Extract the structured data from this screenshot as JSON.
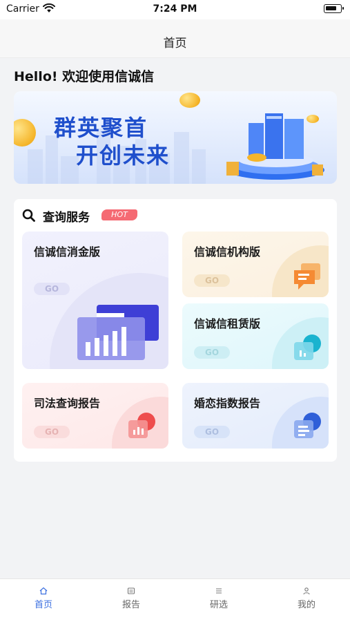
{
  "status_bar": {
    "carrier": "Carrier",
    "time": "7:24 PM"
  },
  "nav": {
    "title": "首页"
  },
  "greeting": "Hello! 欢迎使用信诚信",
  "banner": {
    "slogan_line1": "群英聚首",
    "slogan_line2": "开创未来"
  },
  "services": {
    "title": "查询服务",
    "hot_badge": "HOT",
    "tiles": [
      {
        "label": "信诚信消金版",
        "go": "GO"
      },
      {
        "label": "信诚信机构版",
        "go": "GO"
      },
      {
        "label": "信诚信租赁版",
        "go": "GO"
      },
      {
        "label": "司法查询报告",
        "go": "GO"
      },
      {
        "label": "婚恋指数报告",
        "go": "GO"
      }
    ]
  },
  "tab_bar": {
    "active_color": "#3b6fe0",
    "items": [
      {
        "label": "首页",
        "icon": "home-icon",
        "active": true
      },
      {
        "label": "报告",
        "icon": "report-icon",
        "active": false
      },
      {
        "label": "研选",
        "icon": "list-icon",
        "active": false
      },
      {
        "label": "我的",
        "icon": "user-icon",
        "active": false
      }
    ]
  }
}
